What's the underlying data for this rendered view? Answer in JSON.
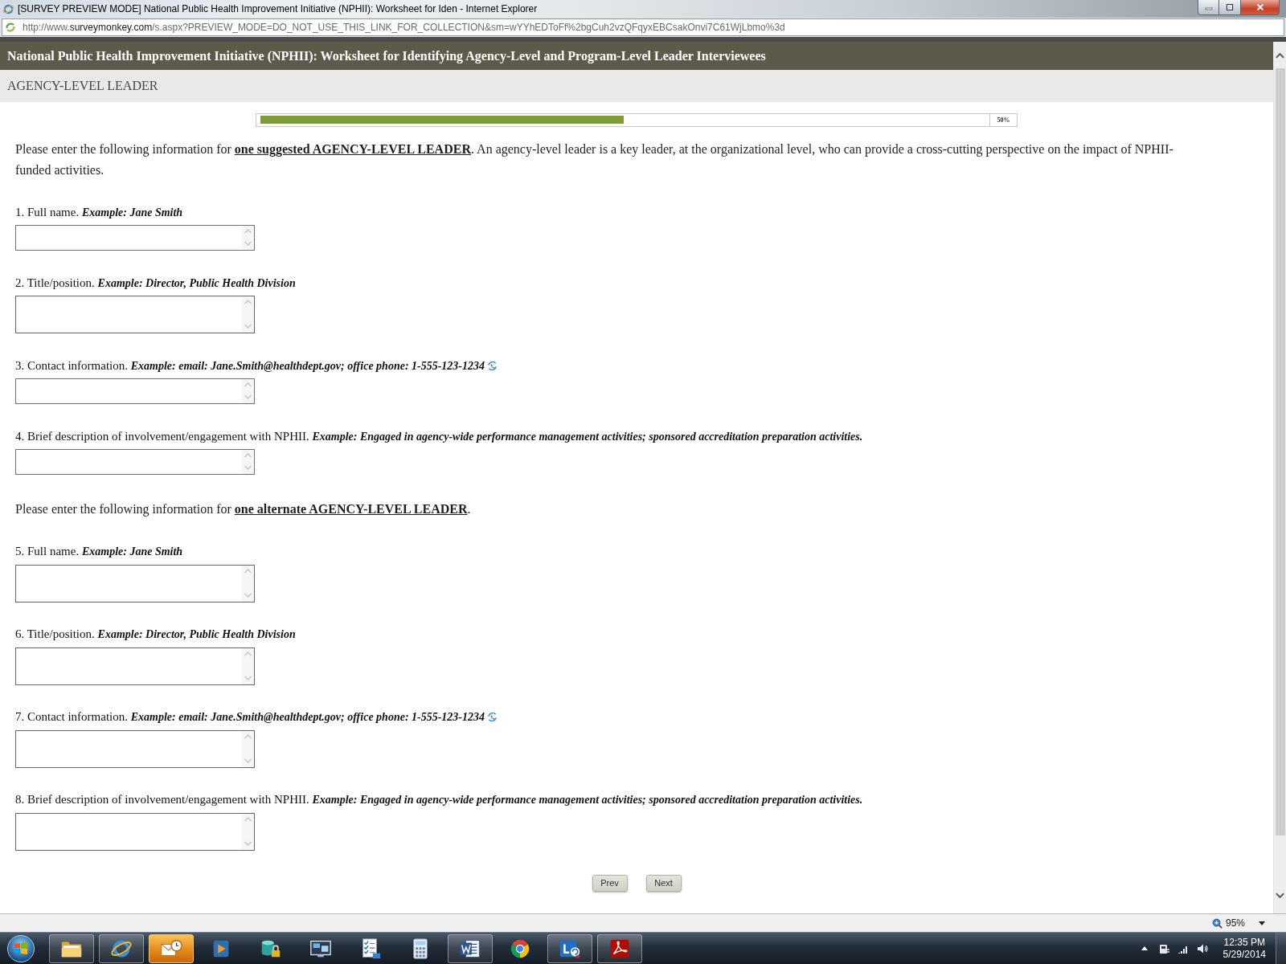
{
  "window": {
    "title": "[SURVEY PREVIEW MODE] National Public Health Improvement Initiative (NPHII): Worksheet for Iden - Internet Explorer"
  },
  "address_bar": {
    "url_start": "http://www.",
    "url_host": "surveymonkey.com",
    "url_rest": "/s.aspx?PREVIEW_MODE=DO_NOT_USE_THIS_LINK_FOR_COLLECTION&sm=wYYhEDToFf%2bgCuh2vzQFqyxEBCsakOnvi7C61WjLbmo%3d"
  },
  "survey": {
    "title": "National Public Health Improvement Initiative (NPHII): Worksheet for Identifying Agency-Level and Program-Level Leader Interviewees",
    "page_title": "AGENCY-LEVEL LEADER",
    "progress": {
      "level": 0.5,
      "label": "50%"
    },
    "blocks": [
      {
        "kind": "intro",
        "text": "Please enter the following information for **one suggested AGENCY-LEVEL LEADER**. An agency-level leader is a key leader, at the organizational level, who can provide a cross-cutting perspective on the impact of NPHII-funded activities."
      },
      {
        "kind": "question",
        "text": "1. Full name. *Example: Jane Smith*",
        "tall": false,
        "call_icon": false
      },
      {
        "kind": "question",
        "text": "2. Title/position. *Example: Director, Public Health Division*",
        "tall": true,
        "call_icon": false
      },
      {
        "kind": "question",
        "text": "3. Contact information. *Example: email: Jane.Smith@healthdept.gov; office phone: 1-555-123-1234*",
        "tall": false,
        "call_icon": true
      },
      {
        "kind": "question",
        "text": "4. Brief description of involvement/engagement with NPHII. *Example: Engaged in agency-wide performance management activities; sponsored accreditation preparation activities.*",
        "tall": false,
        "call_icon": false
      },
      {
        "kind": "intro",
        "text": "Please enter the following information for **one alternate AGENCY-LEVEL LEADER**."
      },
      {
        "kind": "question",
        "text": "5. Full name. *Example: Jane Smith*",
        "tall": true,
        "call_icon": false
      },
      {
        "kind": "question",
        "text": "6. Title/position. *Example: Director, Public Health Division*",
        "tall": true,
        "call_icon": false
      },
      {
        "kind": "question",
        "text": "7. Contact information. *Example: email: Jane.Smith@healthdept.gov; office phone: 1-555-123-1234*",
        "tall": true,
        "call_icon": true
      },
      {
        "kind": "question",
        "text": "8. Brief description of involvement/engagement with NPHII. *Example: Engaged in agency-wide performance management activities; sponsored accreditation preparation activities.*",
        "tall": true,
        "call_icon": false
      }
    ],
    "buttons": [
      "Prev",
      "Next"
    ]
  },
  "status_bar": {
    "zoom": "95%"
  },
  "taskbar": {
    "apps": [
      {
        "kind": "folder",
        "running": true,
        "alert": false
      },
      {
        "kind": "browser",
        "running": true,
        "alert": false
      },
      {
        "kind": "mail",
        "running": false,
        "alert": true
      },
      {
        "kind": "media",
        "running": false,
        "alert": false
      },
      {
        "kind": "database",
        "running": false,
        "alert": false
      },
      {
        "kind": "monitor",
        "running": false,
        "alert": false
      },
      {
        "kind": "checklist",
        "running": false,
        "alert": false
      },
      {
        "kind": "calculator",
        "running": false,
        "alert": false
      },
      {
        "kind": "document",
        "running": true,
        "alert": false
      },
      {
        "kind": "circle",
        "running": false,
        "alert": false
      },
      {
        "kind": "chat",
        "running": true,
        "alert": false
      },
      {
        "kind": "pdf",
        "running": true,
        "alert": false
      }
    ],
    "clock": {
      "time": "12:35 PM",
      "date": "5/29/2014"
    }
  }
}
